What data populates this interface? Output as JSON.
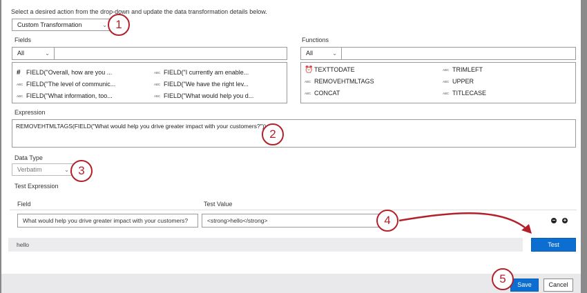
{
  "instructions": "Select a desired action from the drop-down and update the data transformation details below.",
  "action_select": "Custom Transformation",
  "fields": {
    "label": "Fields",
    "filter": "All",
    "search": "",
    "items": [
      {
        "icon": "number-icon",
        "label": "FIELD(\"Overall, how are you ..."
      },
      {
        "icon": "text-icon",
        "label": "FIELD(\"I currently am enable..."
      },
      {
        "icon": "text-icon",
        "label": "FIELD(\"The level of communic..."
      },
      {
        "icon": "text-icon",
        "label": "FIELD(\"We have the right lev..."
      },
      {
        "icon": "text-icon",
        "label": "FIELD(\"What information, too..."
      },
      {
        "icon": "text-icon",
        "label": "FIELD(\"What would help you d..."
      }
    ]
  },
  "functions": {
    "label": "Functions",
    "filter": "All",
    "search": "",
    "items": [
      {
        "icon": "alarm-clock-icon",
        "label": "TEXTTODATE"
      },
      {
        "icon": "text-icon",
        "label": "TRIMLEFT"
      },
      {
        "icon": "text-icon",
        "label": "REMOVEHTMLTAGS"
      },
      {
        "icon": "text-icon",
        "label": "UPPER"
      },
      {
        "icon": "text-icon",
        "label": "CONCAT"
      },
      {
        "icon": "text-icon",
        "label": "TITLECASE"
      }
    ]
  },
  "expression": {
    "label": "Expression",
    "value": "REMOVEHTMLTAGS(FIELD(\"What would help you drive greater impact with your customers?\"))"
  },
  "data_type": {
    "label": "Data Type",
    "value": "Verbatim"
  },
  "test": {
    "label": "Test Expression",
    "field_header": "Field",
    "value_header": "Test Value",
    "field_value": "What would help you drive greater impact with your customers?",
    "test_value": "<strong>hello</strong>",
    "result": "hello",
    "button": "Test"
  },
  "footer": {
    "save": "Save",
    "cancel": "Cancel"
  },
  "steps": [
    "1",
    "2",
    "3",
    "4",
    "5"
  ],
  "icon_text": "ABC",
  "colors": {
    "accent": "#0b6ed0",
    "annotation": "#b3202a"
  }
}
